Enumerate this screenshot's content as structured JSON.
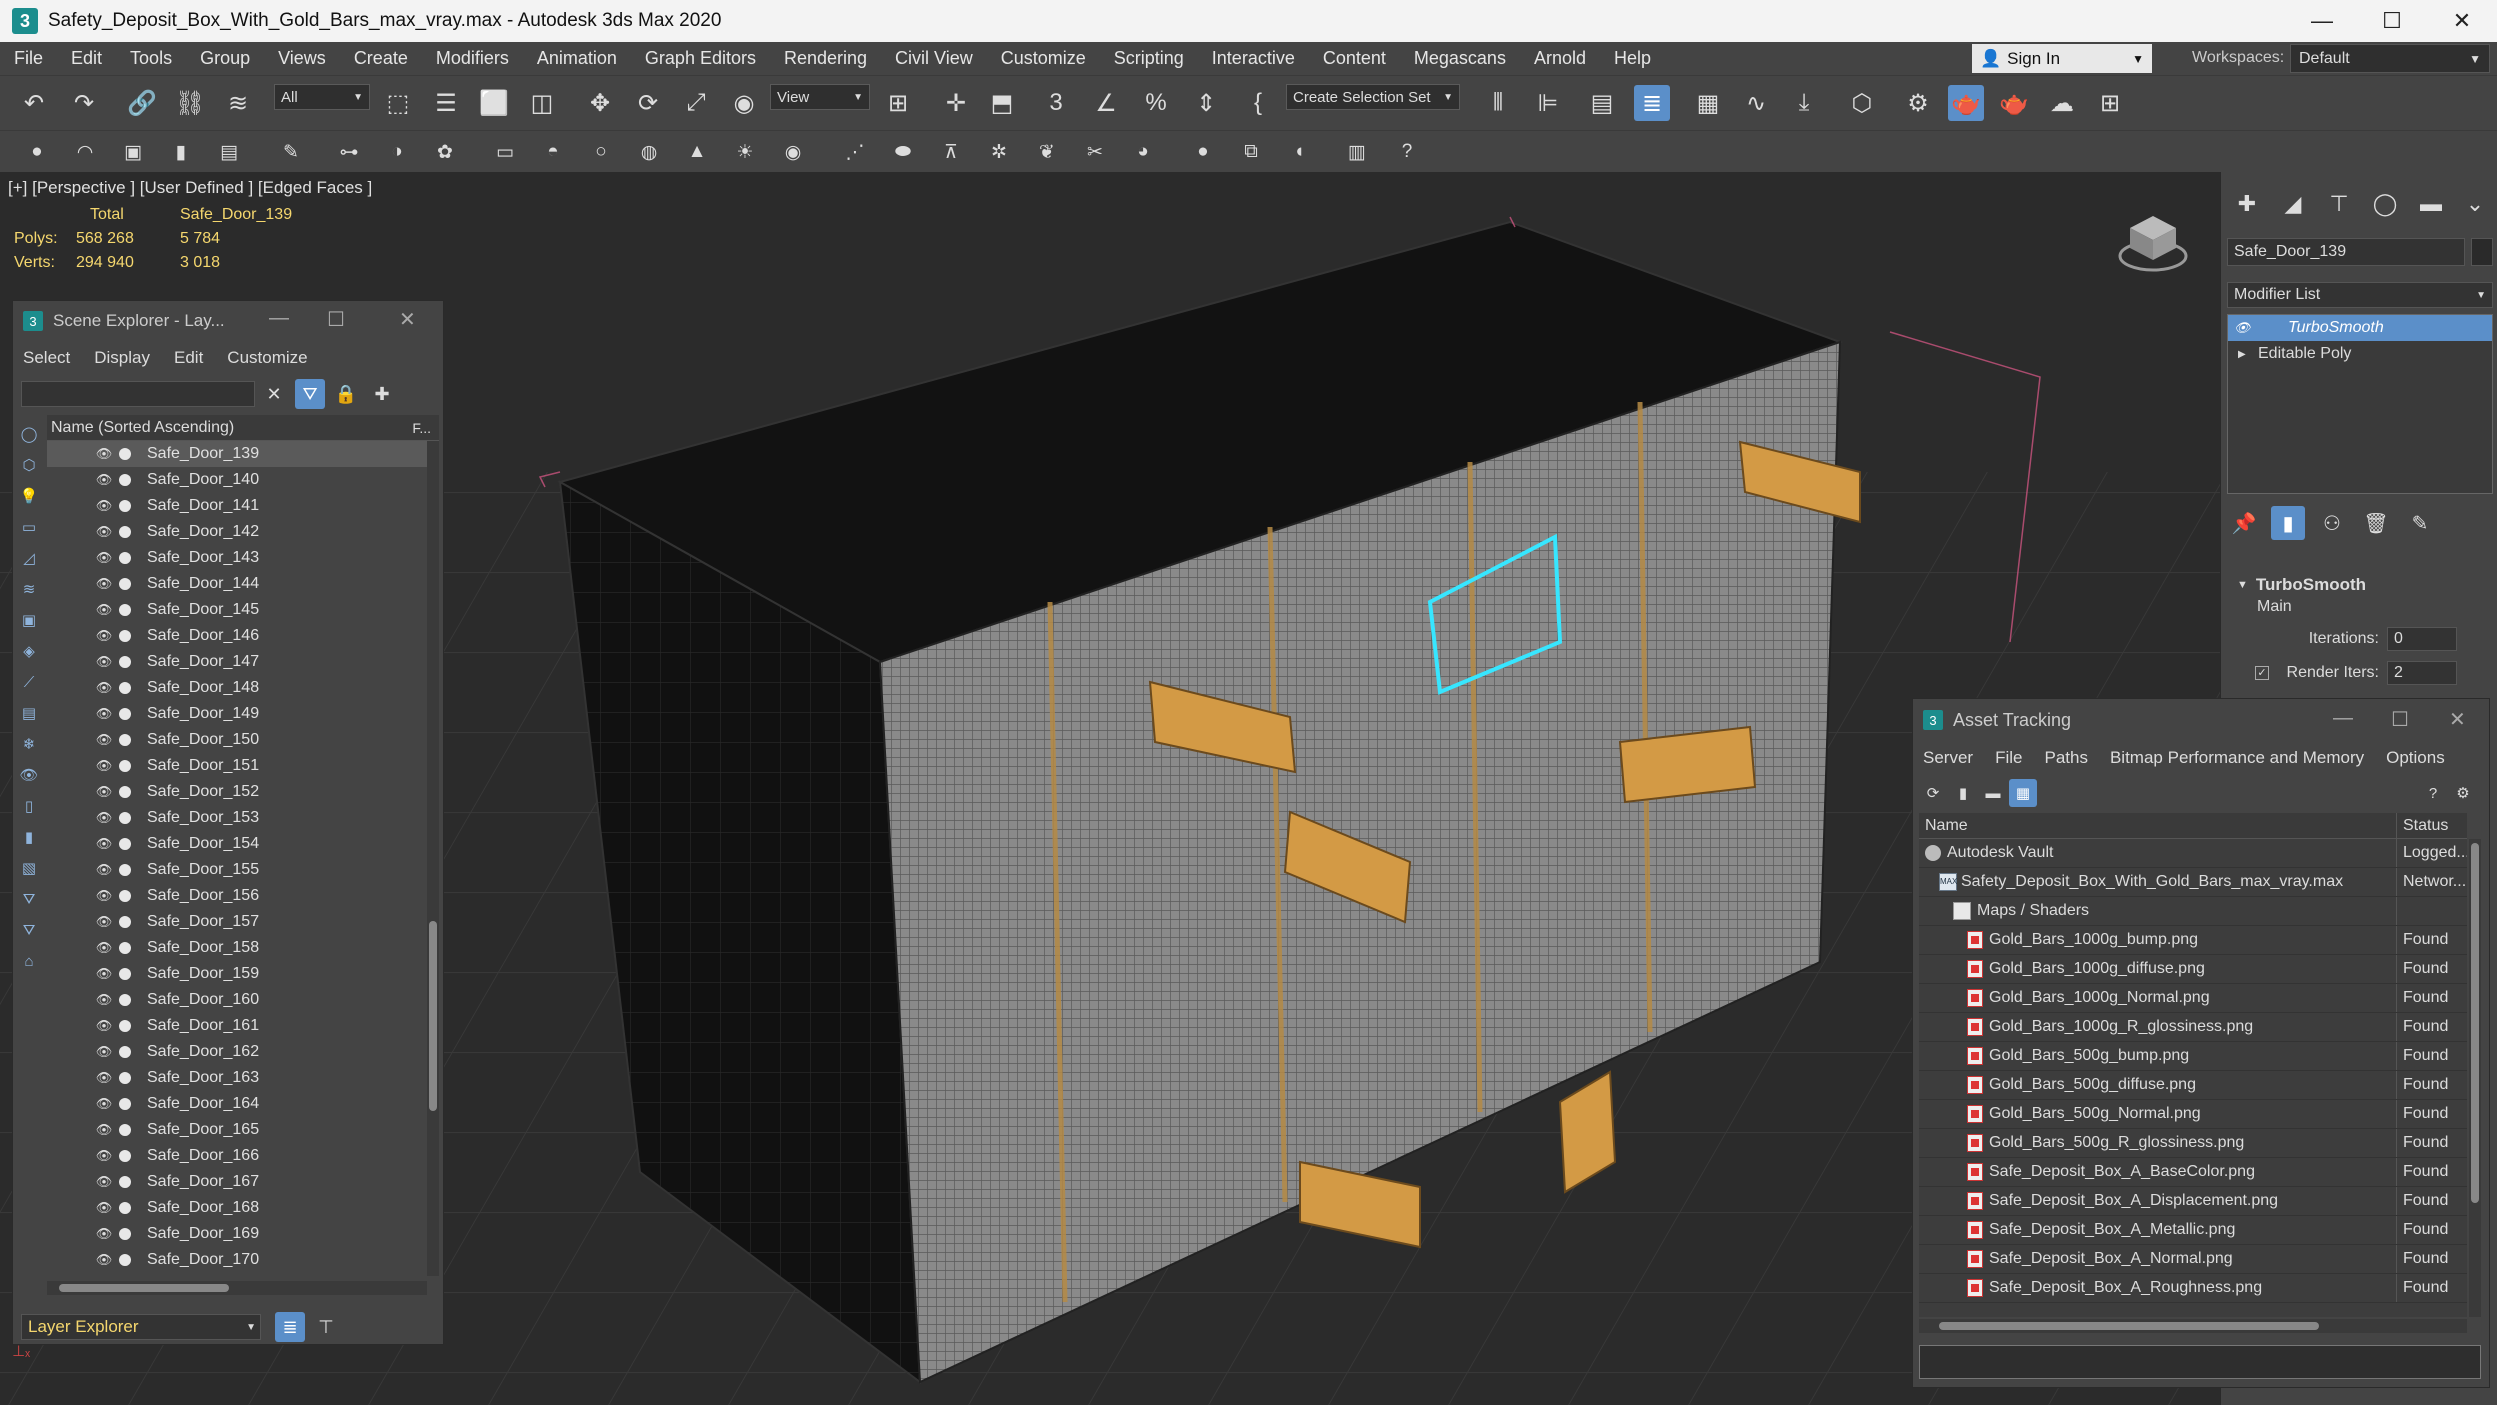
{
  "window": {
    "title": "Safety_Deposit_Box_With_Gold_Bars_max_vray.max - Autodesk 3ds Max 2020",
    "app_icon": "3"
  },
  "menu": [
    "File",
    "Edit",
    "Tools",
    "Group",
    "Views",
    "Create",
    "Modifiers",
    "Animation",
    "Graph Editors",
    "Rendering",
    "Civil View",
    "Customize",
    "Scripting",
    "Interactive",
    "Content",
    "Megascans",
    "Arnold",
    "Help"
  ],
  "signin": {
    "label": "Sign In"
  },
  "workspaces": {
    "label": "Workspaces:",
    "value": "Default"
  },
  "toolbar": {
    "filter_value": "All",
    "refcoord_value": "View",
    "selection_set_placeholder": "Create Selection Set"
  },
  "viewport": {
    "label": "[+] [Perspective ] [User Defined ] [Edged Faces ]",
    "stats": {
      "total_label": "Total",
      "object_label": "Safe_Door_139",
      "polys_label": "Polys:",
      "polys_total": "568 268",
      "polys_object": "5 784",
      "verts_label": "Verts:",
      "verts_total": "294 940",
      "verts_object": "3 018"
    }
  },
  "scene_explorer": {
    "title": "Scene Explorer - Lay...",
    "menu": [
      "Select",
      "Display",
      "Edit",
      "Customize"
    ],
    "column_name": "Name (Sorted Ascending)",
    "column_f": "F...",
    "items": [
      "Safe_Door_139",
      "Safe_Door_140",
      "Safe_Door_141",
      "Safe_Door_142",
      "Safe_Door_143",
      "Safe_Door_144",
      "Safe_Door_145",
      "Safe_Door_146",
      "Safe_Door_147",
      "Safe_Door_148",
      "Safe_Door_149",
      "Safe_Door_150",
      "Safe_Door_151",
      "Safe_Door_152",
      "Safe_Door_153",
      "Safe_Door_154",
      "Safe_Door_155",
      "Safe_Door_156",
      "Safe_Door_157",
      "Safe_Door_158",
      "Safe_Door_159",
      "Safe_Door_160",
      "Safe_Door_161",
      "Safe_Door_162",
      "Safe_Door_163",
      "Safe_Door_164",
      "Safe_Door_165",
      "Safe_Door_166",
      "Safe_Door_167",
      "Safe_Door_168",
      "Safe_Door_169",
      "Safe_Door_170"
    ],
    "selected_index": 0,
    "layer_explorer": "Layer Explorer"
  },
  "command_panel": {
    "object_name": "Safe_Door_139",
    "modifier_list": "Modifier List",
    "stack": [
      {
        "label": "TurboSmooth",
        "active": true
      },
      {
        "label": "Editable Poly",
        "active": false
      }
    ],
    "rollout": {
      "title": "TurboSmooth",
      "section": "Main",
      "iterations_label": "Iterations:",
      "iterations_value": "0",
      "render_iters_label": "Render Iters:",
      "render_iters_value": "2"
    }
  },
  "asset_tracking": {
    "title": "Asset Tracking",
    "menu": [
      "Server",
      "File",
      "Paths",
      "Bitmap Performance and Memory",
      "Options"
    ],
    "col_name": "Name",
    "col_status": "Status",
    "rows": [
      {
        "name": "Autodesk Vault",
        "status": "Logged...",
        "indent": 1,
        "icon": "vault"
      },
      {
        "name": "Safety_Deposit_Box_With_Gold_Bars_max_vray.max",
        "status": "Networ...",
        "indent": 2,
        "icon": "max"
      },
      {
        "name": "Maps / Shaders",
        "status": "",
        "indent": 3,
        "icon": "folder"
      },
      {
        "name": "Gold_Bars_1000g_bump.png",
        "status": "Found",
        "indent": 4,
        "icon": "file"
      },
      {
        "name": "Gold_Bars_1000g_diffuse.png",
        "status": "Found",
        "indent": 4,
        "icon": "file"
      },
      {
        "name": "Gold_Bars_1000g_Normal.png",
        "status": "Found",
        "indent": 4,
        "icon": "file"
      },
      {
        "name": "Gold_Bars_1000g_R_glossiness.png",
        "status": "Found",
        "indent": 4,
        "icon": "file"
      },
      {
        "name": "Gold_Bars_500g_bump.png",
        "status": "Found",
        "indent": 4,
        "icon": "file"
      },
      {
        "name": "Gold_Bars_500g_diffuse.png",
        "status": "Found",
        "indent": 4,
        "icon": "file"
      },
      {
        "name": "Gold_Bars_500g_Normal.png",
        "status": "Found",
        "indent": 4,
        "icon": "file"
      },
      {
        "name": "Gold_Bars_500g_R_glossiness.png",
        "status": "Found",
        "indent": 4,
        "icon": "file"
      },
      {
        "name": "Safe_Deposit_Box_A_BaseColor.png",
        "status": "Found",
        "indent": 4,
        "icon": "file"
      },
      {
        "name": "Safe_Deposit_Box_A_Displacement.png",
        "status": "Found",
        "indent": 4,
        "icon": "file"
      },
      {
        "name": "Safe_Deposit_Box_A_Metallic.png",
        "status": "Found",
        "indent": 4,
        "icon": "file"
      },
      {
        "name": "Safe_Deposit_Box_A_Normal.png",
        "status": "Found",
        "indent": 4,
        "icon": "file"
      },
      {
        "name": "Safe_Deposit_Box_A_Roughness.png",
        "status": "Found",
        "indent": 4,
        "icon": "file"
      }
    ]
  },
  "colors": {
    "accent": "#5b8fc9",
    "stats_yellow": "#f5d76e",
    "selection_cyan": "#37e6ff",
    "gold": "#d39a45"
  }
}
